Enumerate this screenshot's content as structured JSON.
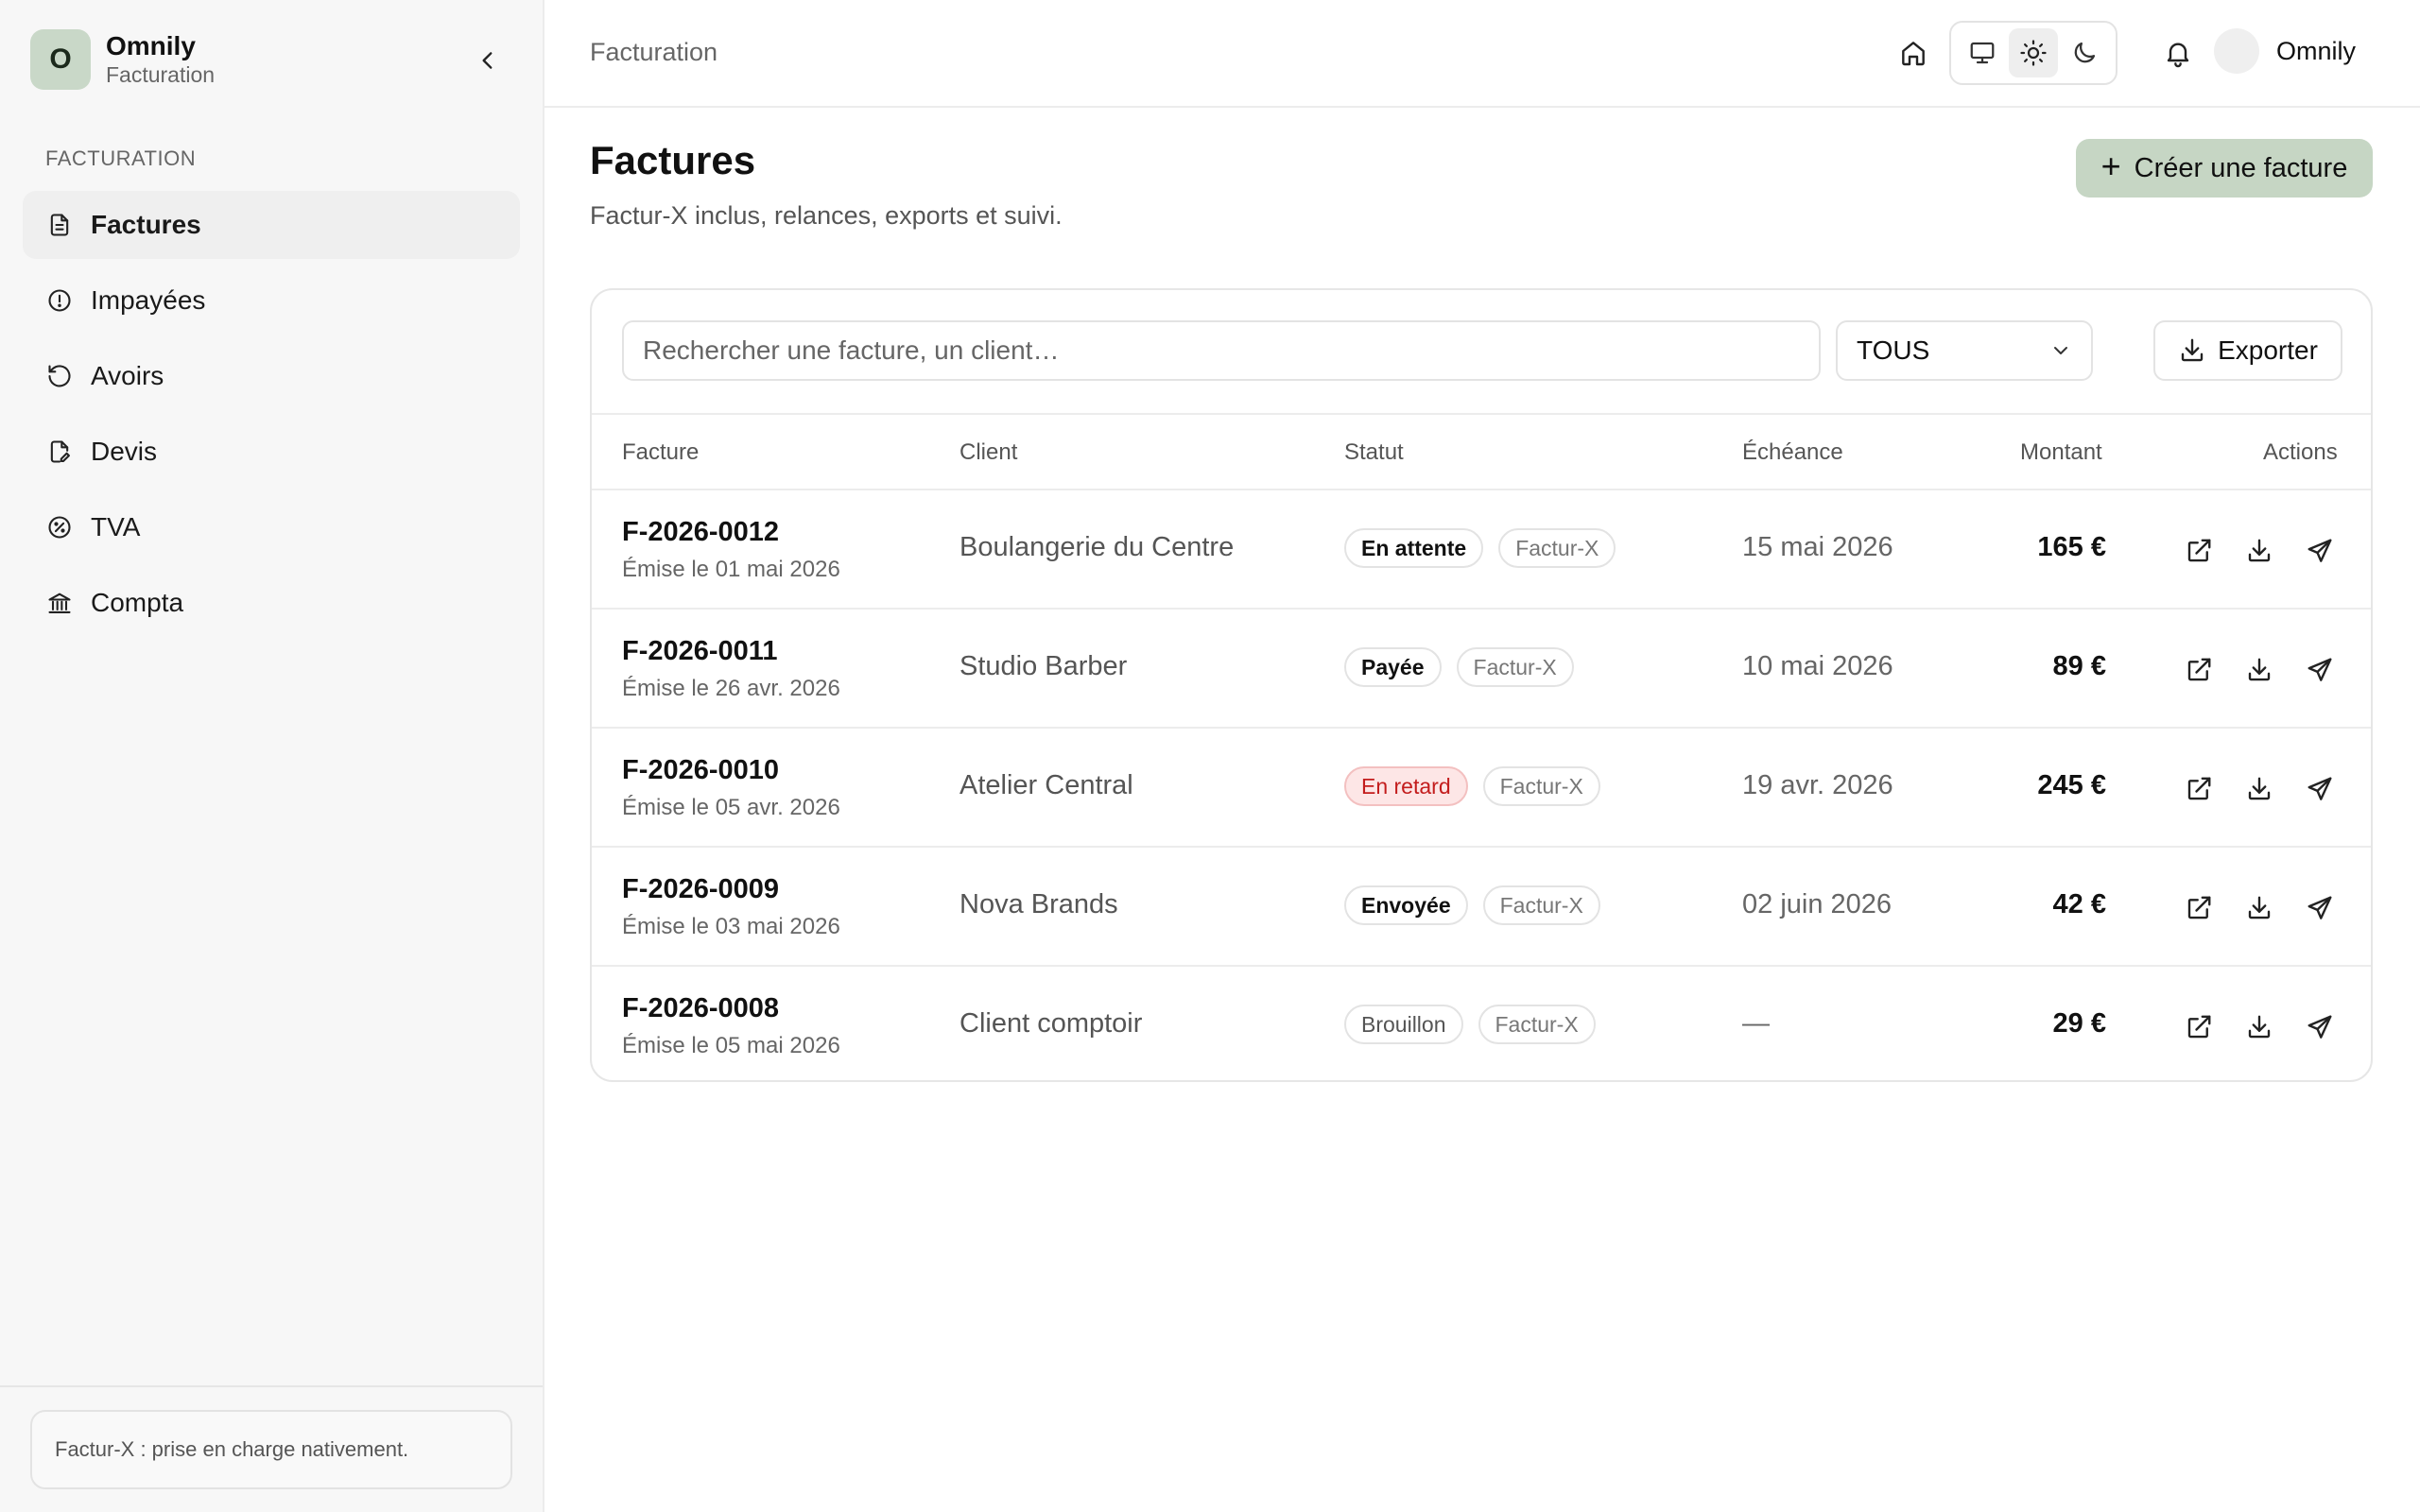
{
  "sidebar": {
    "brand_initial": "O",
    "brand_name": "Omnily",
    "brand_sub": "Facturation",
    "section_label": "FACTURATION",
    "items": [
      {
        "label": "Factures",
        "icon": "document-icon",
        "active": true
      },
      {
        "label": "Impayées",
        "icon": "alert-circle-icon",
        "active": false
      },
      {
        "label": "Avoirs",
        "icon": "rotate-ccw-icon",
        "active": false
      },
      {
        "label": "Devis",
        "icon": "file-edit-icon",
        "active": false
      },
      {
        "label": "TVA",
        "icon": "percent-badge-icon",
        "active": false
      },
      {
        "label": "Compta",
        "icon": "bank-icon",
        "active": false
      }
    ],
    "note": "Factur-X : prise en charge nativement."
  },
  "header": {
    "breadcrumb": "Facturation",
    "user_name": "Omnily",
    "theme_active": "light"
  },
  "main": {
    "title": "Factures",
    "subtitle": "Factur-X inclus, relances, exports et suivi.",
    "create_label": "Créer une facture",
    "search_placeholder": "Rechercher une facture, un client…",
    "filter_value": "TOUS",
    "export_label": "Exporter",
    "columns": {
      "invoice": "Facture",
      "client": "Client",
      "status": "Statut",
      "due": "Échéance",
      "amount": "Montant",
      "actions": "Actions"
    },
    "rows": [
      {
        "id": "F-2026-0012",
        "issued": "Émise le 01 mai 2026",
        "client": "Boulangerie du Centre",
        "status": "En attente",
        "format": "Factur-X",
        "due": "15 mai 2026",
        "amount": "165 €"
      },
      {
        "id": "F-2026-0011",
        "issued": "Émise le 26 avr. 2026",
        "client": "Studio Barber",
        "status": "Payée",
        "format": "Factur-X",
        "due": "10 mai 2026",
        "amount": "89 €"
      },
      {
        "id": "F-2026-0010",
        "issued": "Émise le 05 avr. 2026",
        "client": "Atelier Central",
        "status": "En retard",
        "format": "Factur-X",
        "due": "19 avr. 2026",
        "amount": "245 €"
      },
      {
        "id": "F-2026-0009",
        "issued": "Émise le 03 mai 2026",
        "client": "Nova Brands",
        "status": "Envoyée",
        "format": "Factur-X",
        "due": "02 juin 2026",
        "amount": "42 €"
      },
      {
        "id": "F-2026-0008",
        "issued": "Émise le 05 mai 2026",
        "client": "Client comptoir",
        "status": "Brouillon",
        "format": "Factur-X",
        "due": "—",
        "amount": "29 €"
      }
    ]
  },
  "colors": {
    "accent": "#c6d6c4",
    "late_bg": "#fde6e6",
    "late_text": "#c31d1d"
  }
}
